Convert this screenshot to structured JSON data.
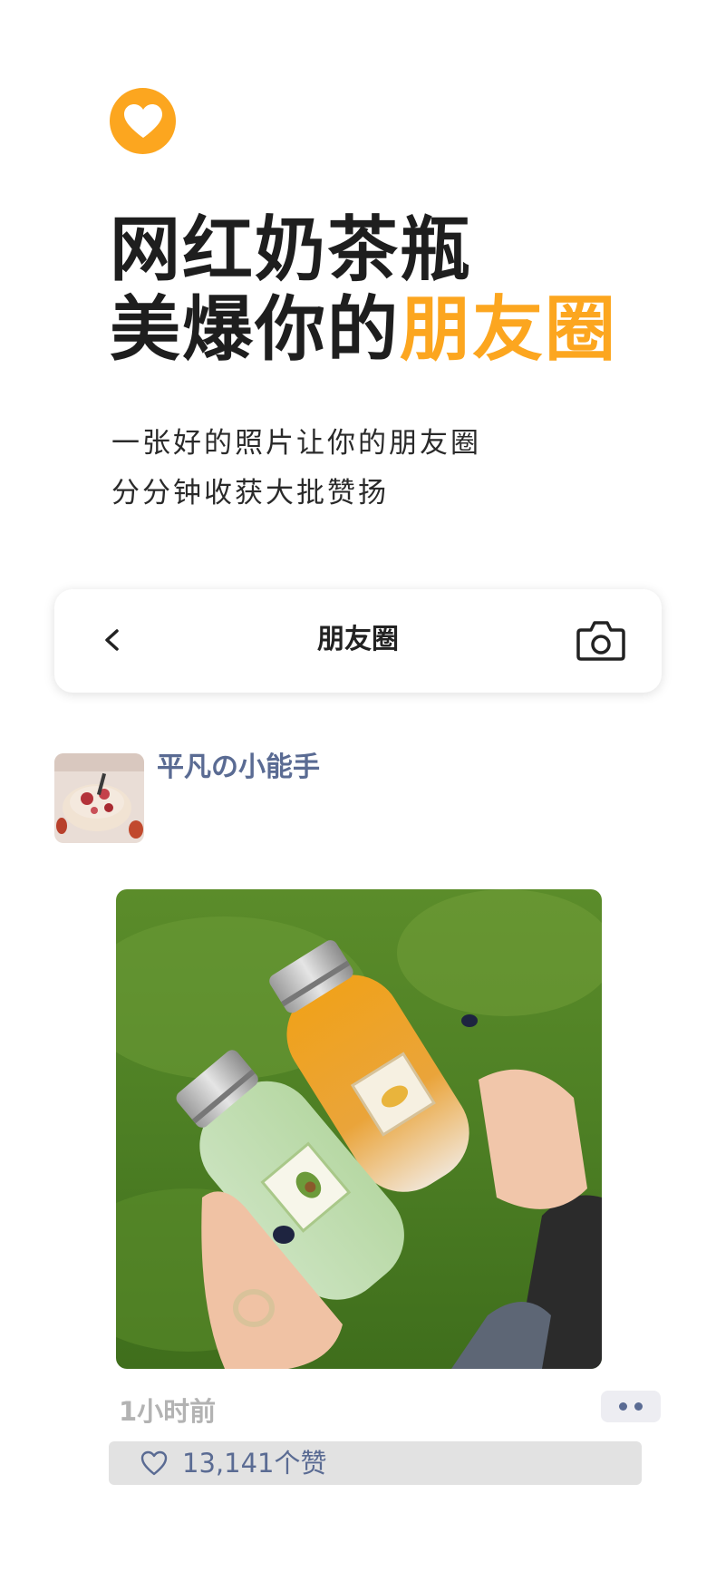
{
  "hero": {
    "line1": "网红奶茶瓶",
    "line2_plain": "美爆你的",
    "line2_accent": "朋友圈",
    "subtitle_line1": "一张好的照片让你的朋友圈",
    "subtitle_line2": "分分钟收获大批赞扬"
  },
  "navbar": {
    "back": "<",
    "title": "朋友圈"
  },
  "post": {
    "username": "平凡の小能手",
    "time": "1小时前",
    "likes": "13,141个赞"
  },
  "colors": {
    "accent": "#fca61f",
    "username": "#5a6b93",
    "text": "#1e1e1e"
  }
}
